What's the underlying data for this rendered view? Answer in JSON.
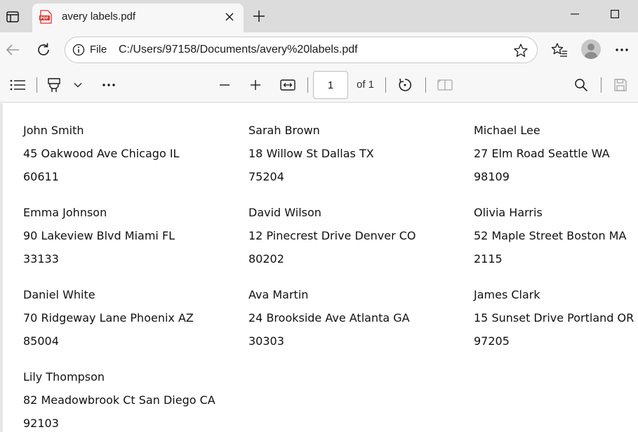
{
  "tab": {
    "title": "avery labels.pdf",
    "favicon_text": "PDF"
  },
  "address_bar": {
    "scheme_label": "File",
    "url": "C:/Users/97158/Documents/avery%20labels.pdf"
  },
  "pdf_toolbar": {
    "page_current": "1",
    "page_total_label": "of 1"
  },
  "labels": [
    {
      "name": "John Smith",
      "street": "45 Oakwood Ave Chicago IL",
      "zip": "60611"
    },
    {
      "name": "Sarah Brown",
      "street": "18 Willow St Dallas TX",
      "zip": "75204"
    },
    {
      "name": "Michael Lee",
      "street": "27 Elm Road Seattle WA",
      "zip": "98109"
    },
    {
      "name": "Emma Johnson",
      "street": "90 Lakeview Blvd Miami FL",
      "zip": "33133"
    },
    {
      "name": "David Wilson",
      "street": "12 Pinecrest Drive Denver CO",
      "zip": "80202"
    },
    {
      "name": "Olivia Harris",
      "street": "52 Maple Street Boston MA",
      "zip": "2115"
    },
    {
      "name": "Daniel White",
      "street": "70 Ridgeway Lane Phoenix AZ",
      "zip": "85004"
    },
    {
      "name": "Ava Martin",
      "street": "24 Brookside Ave Atlanta GA",
      "zip": "30303"
    },
    {
      "name": "James Clark",
      "street": "15 Sunset Drive Portland OR",
      "zip": "97205"
    },
    {
      "name": "Lily Thompson",
      "street": "82 Meadowbrook Ct San Diego CA",
      "zip": "92103"
    }
  ],
  "colors": {
    "pdf_favicon": "#e0302a",
    "titlebar": "#dcdcdc",
    "toolbar": "#f7f7f7",
    "document": "#ffffff"
  },
  "icons": {
    "tab_actions": "tab-actions-icon",
    "close": "close-icon",
    "new_tab": "plus-icon",
    "back": "arrow-left-icon",
    "refresh": "refresh-icon",
    "info": "info-icon",
    "favorite": "star-icon",
    "favorites": "favorites-icon",
    "profile": "avatar",
    "more": "ellipsis-icon",
    "contents": "list-icon",
    "draw": "highlighter-icon",
    "zoom_out": "minus-icon",
    "zoom_in": "plus-icon",
    "fit": "fit-width-icon",
    "rotate": "rotate-icon",
    "page_view": "two-page-icon",
    "search": "search-icon",
    "save": "save-icon"
  }
}
